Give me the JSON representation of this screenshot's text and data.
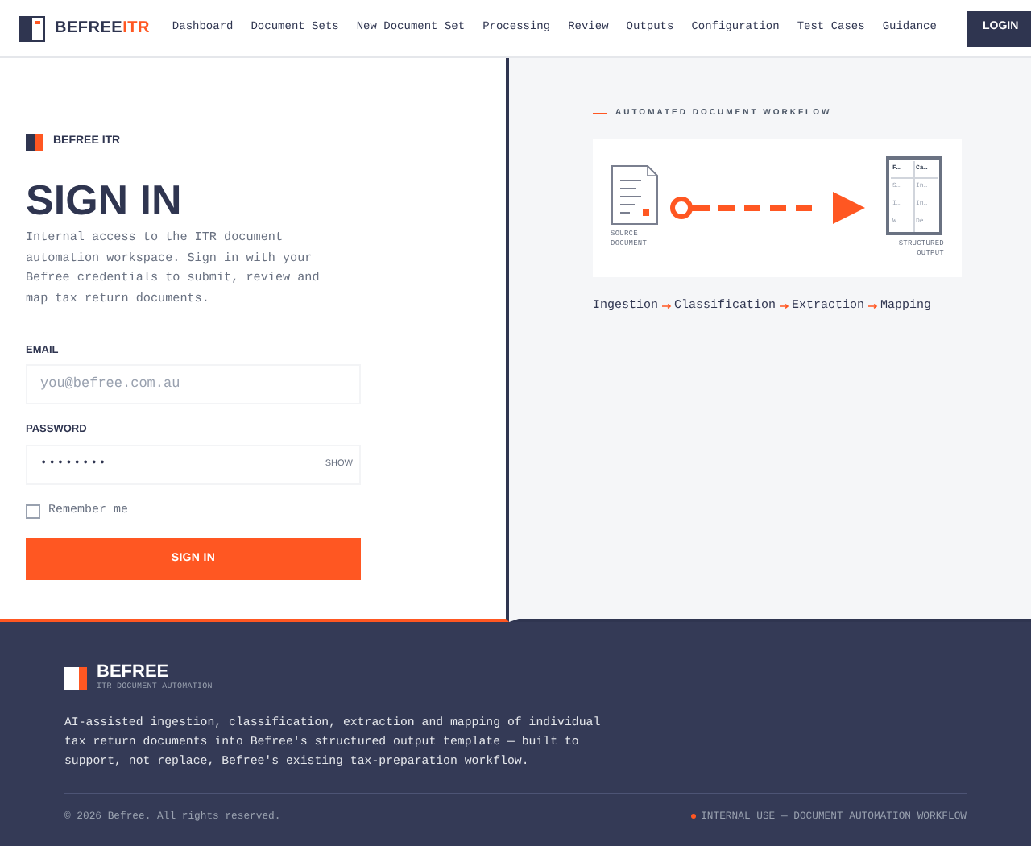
{
  "header": {
    "brand": {
      "main": "BEFREE",
      "accent": "ITR"
    },
    "nav": [
      {
        "label": "Dashboard",
        "selected": false
      },
      {
        "label": "Document Sets",
        "selected": false
      },
      {
        "label": "New Document Set",
        "selected": false
      },
      {
        "label": "Processing",
        "selected": false
      },
      {
        "label": "Review",
        "selected": false
      },
      {
        "label": "Outputs",
        "selected": false
      },
      {
        "label": "Configuration",
        "selected": false
      },
      {
        "label": "Test Cases",
        "selected": false
      },
      {
        "label": "Guidance",
        "selected": false
      }
    ],
    "login_button": "LOGIN"
  },
  "sign_in": {
    "brand": "BEFREE ITR",
    "title": "SIGN IN",
    "description": "Internal access to the ITR document automation workspace. Sign in with your Befree credentials to submit, review and map tax return documents.",
    "email": {
      "label": "EMAIL",
      "placeholder": "you@befree.com.au"
    },
    "password": {
      "label": "PASSWORD",
      "value": "••••••••",
      "toggle": "SHOW"
    },
    "remember": {
      "label": "Remember me",
      "checked": false
    },
    "submit": "SIGN IN"
  },
  "workflow": {
    "eyebrow": "AUTOMATED DOCUMENT WORKFLOW",
    "source_label": "SOURCE DOCUMENT",
    "output_label": "STRUCTURED OUTPUT",
    "output_rows": [
      [
        "F…",
        "Ca…"
      ],
      [
        "S…",
        "In…"
      ],
      [
        "I…",
        "In…"
      ],
      [
        "W…",
        "De…"
      ]
    ],
    "steps": [
      "Ingestion",
      "Classification",
      "Extraction",
      "Mapping"
    ]
  },
  "footer": {
    "brand": "BEFREE",
    "tagline": "ITR DOCUMENT AUTOMATION",
    "description": "AI-assisted ingestion, classification, extraction and mapping of individual tax return documents into Befree's structured output template — built to support, not replace, Befree's existing tax-preparation workflow.",
    "copyright": "© 2026 Befree. All rights reserved.",
    "notice": "INTERNAL USE — DOCUMENT AUTOMATION WORKFLOW"
  }
}
